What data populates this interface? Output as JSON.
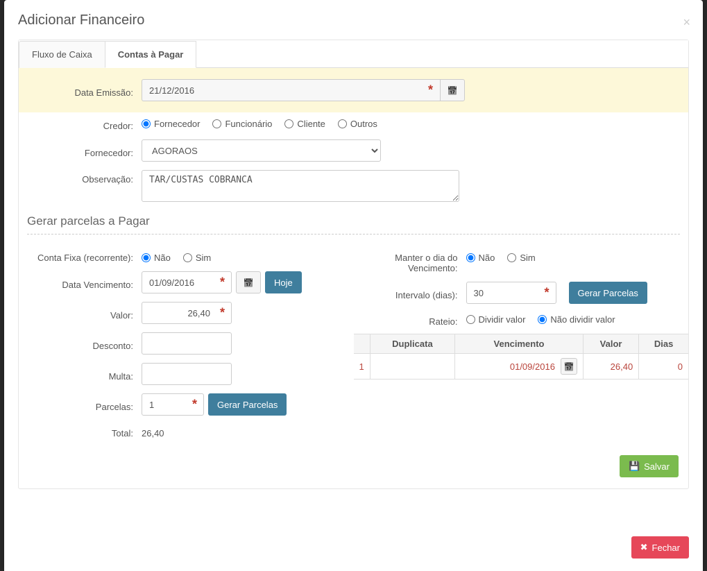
{
  "modal": {
    "title": "Adicionar Financeiro",
    "close_button": "Fechar"
  },
  "tabs": {
    "fluxo": "Fluxo de Caixa",
    "contas": "Contas à Pagar"
  },
  "labels": {
    "data_emissao": "Data Emissão:",
    "credor": "Credor:",
    "fornecedor": "Fornecedor:",
    "observacao": "Observação:",
    "section": "Gerar parcelas a Pagar",
    "conta_fixa": "Conta Fixa (recorrente):",
    "data_vencimento": "Data Vencimento:",
    "valor": "Valor:",
    "desconto": "Desconto:",
    "multa": "Multa:",
    "parcelas": "Parcelas:",
    "total": "Total:",
    "manter_dia": "Manter o dia do Vencimento:",
    "intervalo": "Intervalo (dias):",
    "rateio": "Rateio:",
    "hoje": "Hoje",
    "gerar_parcelas": "Gerar Parcelas",
    "salvar": "Salvar"
  },
  "credor_options": {
    "fornecedor": "Fornecedor",
    "funcionario": "Funcionário",
    "cliente": "Cliente",
    "outros": "Outros"
  },
  "yes_no": {
    "nao": "Não",
    "sim": "Sim"
  },
  "rateio_options": {
    "dividir": "Dividir valor",
    "nao_dividir": "Não dividir valor"
  },
  "values": {
    "data_emissao": "21/12/2016",
    "fornecedor_selected": "AGORAOS",
    "observacao": "TAR/CUSTAS COBRANCA",
    "data_vencimento": "01/09/2016",
    "valor": "26,40",
    "desconto": "",
    "multa": "",
    "parcelas": "1",
    "total": "26,40",
    "intervalo": "30"
  },
  "table": {
    "headers": {
      "duplicata": "Duplicata",
      "vencimento": "Vencimento",
      "valor": "Valor",
      "dias": "Dias"
    },
    "row": {
      "n": "1",
      "venc": "01/09/2016",
      "valor": "26,40",
      "dias": "0"
    }
  }
}
